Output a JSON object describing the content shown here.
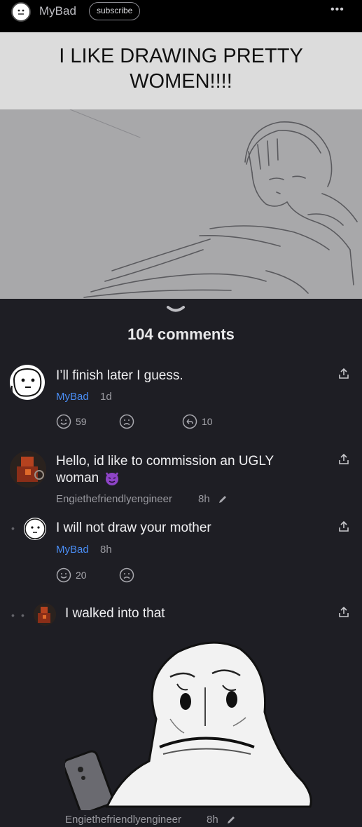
{
  "topbar": {
    "channel_name": "MyBad",
    "subscribe_label": "subscribe",
    "more_icon": "•••"
  },
  "post": {
    "title_line1": "I LIKE DRAWING PRETTY",
    "title_line2": "WOMEN!!!!"
  },
  "comments_header": {
    "count_label": "104 comments"
  },
  "comments": [
    {
      "text": "I’ll finish later I guess.",
      "author": "MyBad",
      "age": "1d",
      "likes": "59",
      "replies": "10"
    },
    {
      "text_line1": "Hello, id like to commission an UGLY",
      "text_line2": "woman",
      "author": "Engiethefriendlyengineer",
      "age": "8h"
    },
    {
      "text": "I will not draw your mother",
      "author": "MyBad",
      "age": "8h",
      "likes": "20"
    },
    {
      "text": "I walked into that",
      "author": "Engiethefriendlyengineer",
      "age": "8h"
    }
  ],
  "colors": {
    "background": "#1e1e24",
    "author_highlight": "#4a8ef5",
    "muted_text": "#9a9aa0"
  }
}
